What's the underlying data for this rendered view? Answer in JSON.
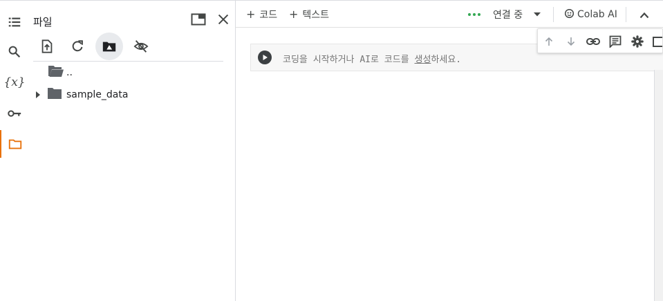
{
  "rail": {
    "items": [
      {
        "name": "toc-icon"
      },
      {
        "name": "search-icon"
      },
      {
        "name": "variables-icon",
        "glyph": "{x}"
      },
      {
        "name": "key-icon"
      },
      {
        "name": "folder-icon",
        "active": true
      }
    ],
    "accent_color": "#e8710a"
  },
  "files_panel": {
    "title": "파일",
    "tree": [
      {
        "label": "..",
        "type": "parent-folder"
      },
      {
        "label": "sample_data",
        "type": "folder",
        "collapsed": true
      }
    ]
  },
  "toolbar": {
    "add_code_label": "코드",
    "add_text_label": "텍스트",
    "connection_status": "연결 중",
    "colab_ai_label": "Colab AI",
    "status_color": "#34a853"
  },
  "cell": {
    "placeholder_prefix": "코딩을 시작하거나 AI로 코드를 ",
    "placeholder_link": "생성",
    "placeholder_suffix": "하세요."
  }
}
